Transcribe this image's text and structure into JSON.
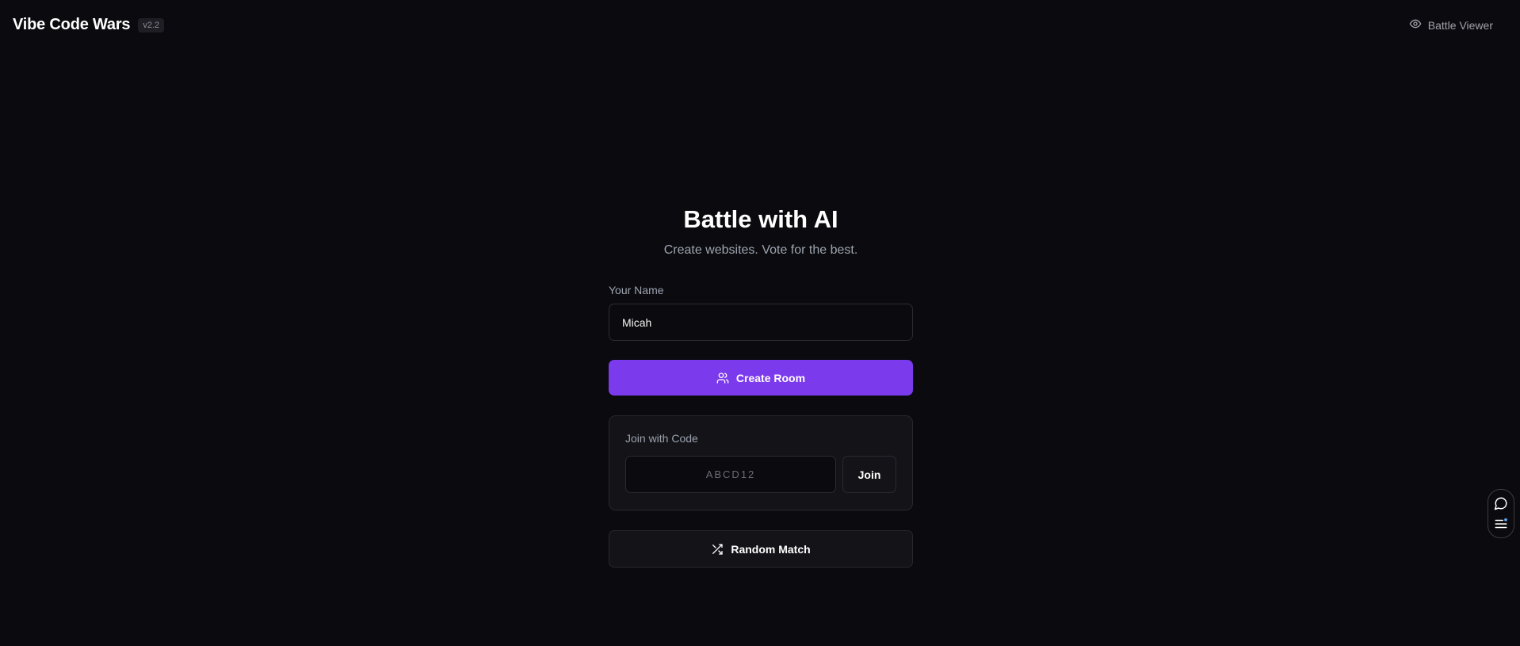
{
  "header": {
    "title": "Vibe Code Wars",
    "version": "v2.2",
    "viewer_label": "Battle Viewer"
  },
  "hero": {
    "title": "Battle with AI",
    "subtitle": "Create websites. Vote for the best."
  },
  "name_field": {
    "label": "Your Name",
    "value": "Micah"
  },
  "create_button": {
    "label": "Create Room",
    "icon": "users-icon"
  },
  "join": {
    "label": "Join with Code",
    "placeholder": "ABCD12",
    "button_label": "Join"
  },
  "random_button": {
    "label": "Random Match",
    "icon": "shuffle-icon"
  },
  "side_widget": {
    "icons": [
      "chat-bubble-icon",
      "menu-list-icon"
    ]
  },
  "colors": {
    "background": "#0b0b0f",
    "accent": "#7c3aed",
    "card": "#131318",
    "muted_text": "#9ca3af"
  }
}
